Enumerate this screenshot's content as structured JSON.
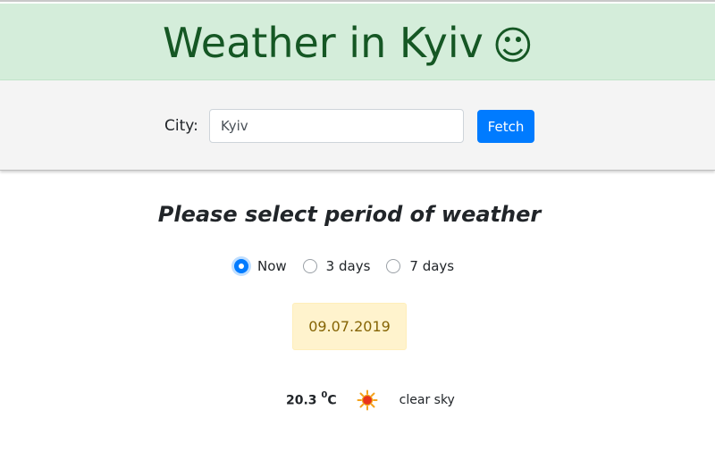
{
  "header": {
    "title": "Weather in Kyiv",
    "icon": "smiley-icon",
    "icon_glyph": "☺",
    "background": "#d4edda",
    "title_color": "#155724"
  },
  "search": {
    "label": "City:",
    "value": "Kyiv",
    "button_label": "Fetch",
    "button_color": "#007bff"
  },
  "period": {
    "heading": "Please select period of weather",
    "options": [
      {
        "label": "Now",
        "selected": true
      },
      {
        "label": "3 days",
        "selected": false
      },
      {
        "label": "7 days",
        "selected": false
      }
    ]
  },
  "forecast": {
    "date": "09.07.2019",
    "temperature": "20.3",
    "degree_mark": "0",
    "unit": "C",
    "icon": "sun-icon",
    "description": "clear sky"
  }
}
